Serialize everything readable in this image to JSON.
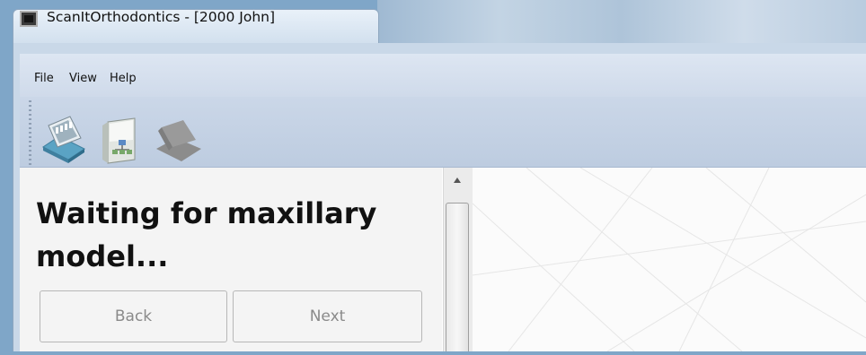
{
  "window": {
    "title": "ScanItOrthodontics - [2000 John]",
    "app_icon": "scanner-app-icon"
  },
  "menu": {
    "items": [
      "File",
      "View",
      "Help"
    ]
  },
  "toolbar": {
    "buttons": [
      {
        "name": "scan-model-icon",
        "enabled": true
      },
      {
        "name": "case-tree-icon",
        "enabled": true
      },
      {
        "name": "scanner-disabled-icon",
        "enabled": false
      }
    ]
  },
  "panel": {
    "heading": "Waiting for maxillary model...",
    "back_label": "Back",
    "next_label": "Next"
  }
}
